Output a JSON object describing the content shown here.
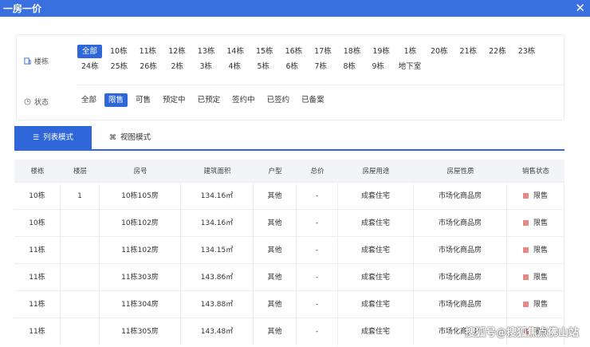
{
  "window": {
    "title": "一房一价",
    "close_label": "✕"
  },
  "filters": {
    "building_label": "楼栋",
    "status_label": "状态",
    "buildings": [
      {
        "label": "全部",
        "active": true
      },
      {
        "label": "10栋"
      },
      {
        "label": "11栋"
      },
      {
        "label": "12栋"
      },
      {
        "label": "13栋"
      },
      {
        "label": "14栋"
      },
      {
        "label": "15栋"
      },
      {
        "label": "16栋"
      },
      {
        "label": "17栋"
      },
      {
        "label": "18栋"
      },
      {
        "label": "19栋"
      },
      {
        "label": "1栋"
      },
      {
        "label": "20栋"
      },
      {
        "label": "21栋"
      },
      {
        "label": "22栋"
      },
      {
        "label": "23栋"
      },
      {
        "label": "24栋"
      },
      {
        "label": "25栋"
      },
      {
        "label": "26栋"
      },
      {
        "label": "2栋"
      },
      {
        "label": "3栋"
      },
      {
        "label": "4栋"
      },
      {
        "label": "5栋"
      },
      {
        "label": "6栋"
      },
      {
        "label": "7栋"
      },
      {
        "label": "8栋"
      },
      {
        "label": "9栋"
      },
      {
        "label": "地下室"
      }
    ],
    "statuses": [
      {
        "label": "全部"
      },
      {
        "label": "限售",
        "active": true
      },
      {
        "label": "可售"
      },
      {
        "label": "预定中"
      },
      {
        "label": "已预定"
      },
      {
        "label": "签约中"
      },
      {
        "label": "已签约"
      },
      {
        "label": "已备案"
      }
    ]
  },
  "tabs": {
    "list_icon": "☰",
    "list_label": "列表模式",
    "view_icon": "⌘",
    "view_label": "视图模式"
  },
  "table": {
    "headers": [
      "楼栋",
      "楼层",
      "房号",
      "建筑面积",
      "户型",
      "总价",
      "房屋用途",
      "房屋性质",
      "销售状态"
    ],
    "rows": [
      [
        "10栋",
        "1",
        "10栋105房",
        "134.16㎡",
        "其他",
        "-",
        "成套住宅",
        "市场化商品房",
        "限售"
      ],
      [
        "10栋",
        "",
        "10栋102房",
        "134.16㎡",
        "其他",
        "-",
        "成套住宅",
        "市场化商品房",
        "限售"
      ],
      [
        "11栋",
        "",
        "11栋102房",
        "134.15㎡",
        "其他",
        "-",
        "成套住宅",
        "市场化商品房",
        "限售"
      ],
      [
        "11栋",
        "",
        "11栋303房",
        "143.86㎡",
        "其他",
        "-",
        "成套住宅",
        "市场化商品房",
        "限售"
      ],
      [
        "11栋",
        "",
        "11栋304房",
        "143.88㎡",
        "其他",
        "-",
        "成套住宅",
        "市场化商品房",
        "限售"
      ],
      [
        "11栋",
        "",
        "11栋305房",
        "143.48㎡",
        "其他",
        "-",
        "成套住宅",
        "市场化商品房",
        "限售"
      ]
    ]
  },
  "colors": {
    "accent": "#2f66d9",
    "titlebar": "#3a6fe0",
    "status_restricted": "#e78989"
  },
  "watermark": "搜狐号@搜狐焦点佛山站"
}
